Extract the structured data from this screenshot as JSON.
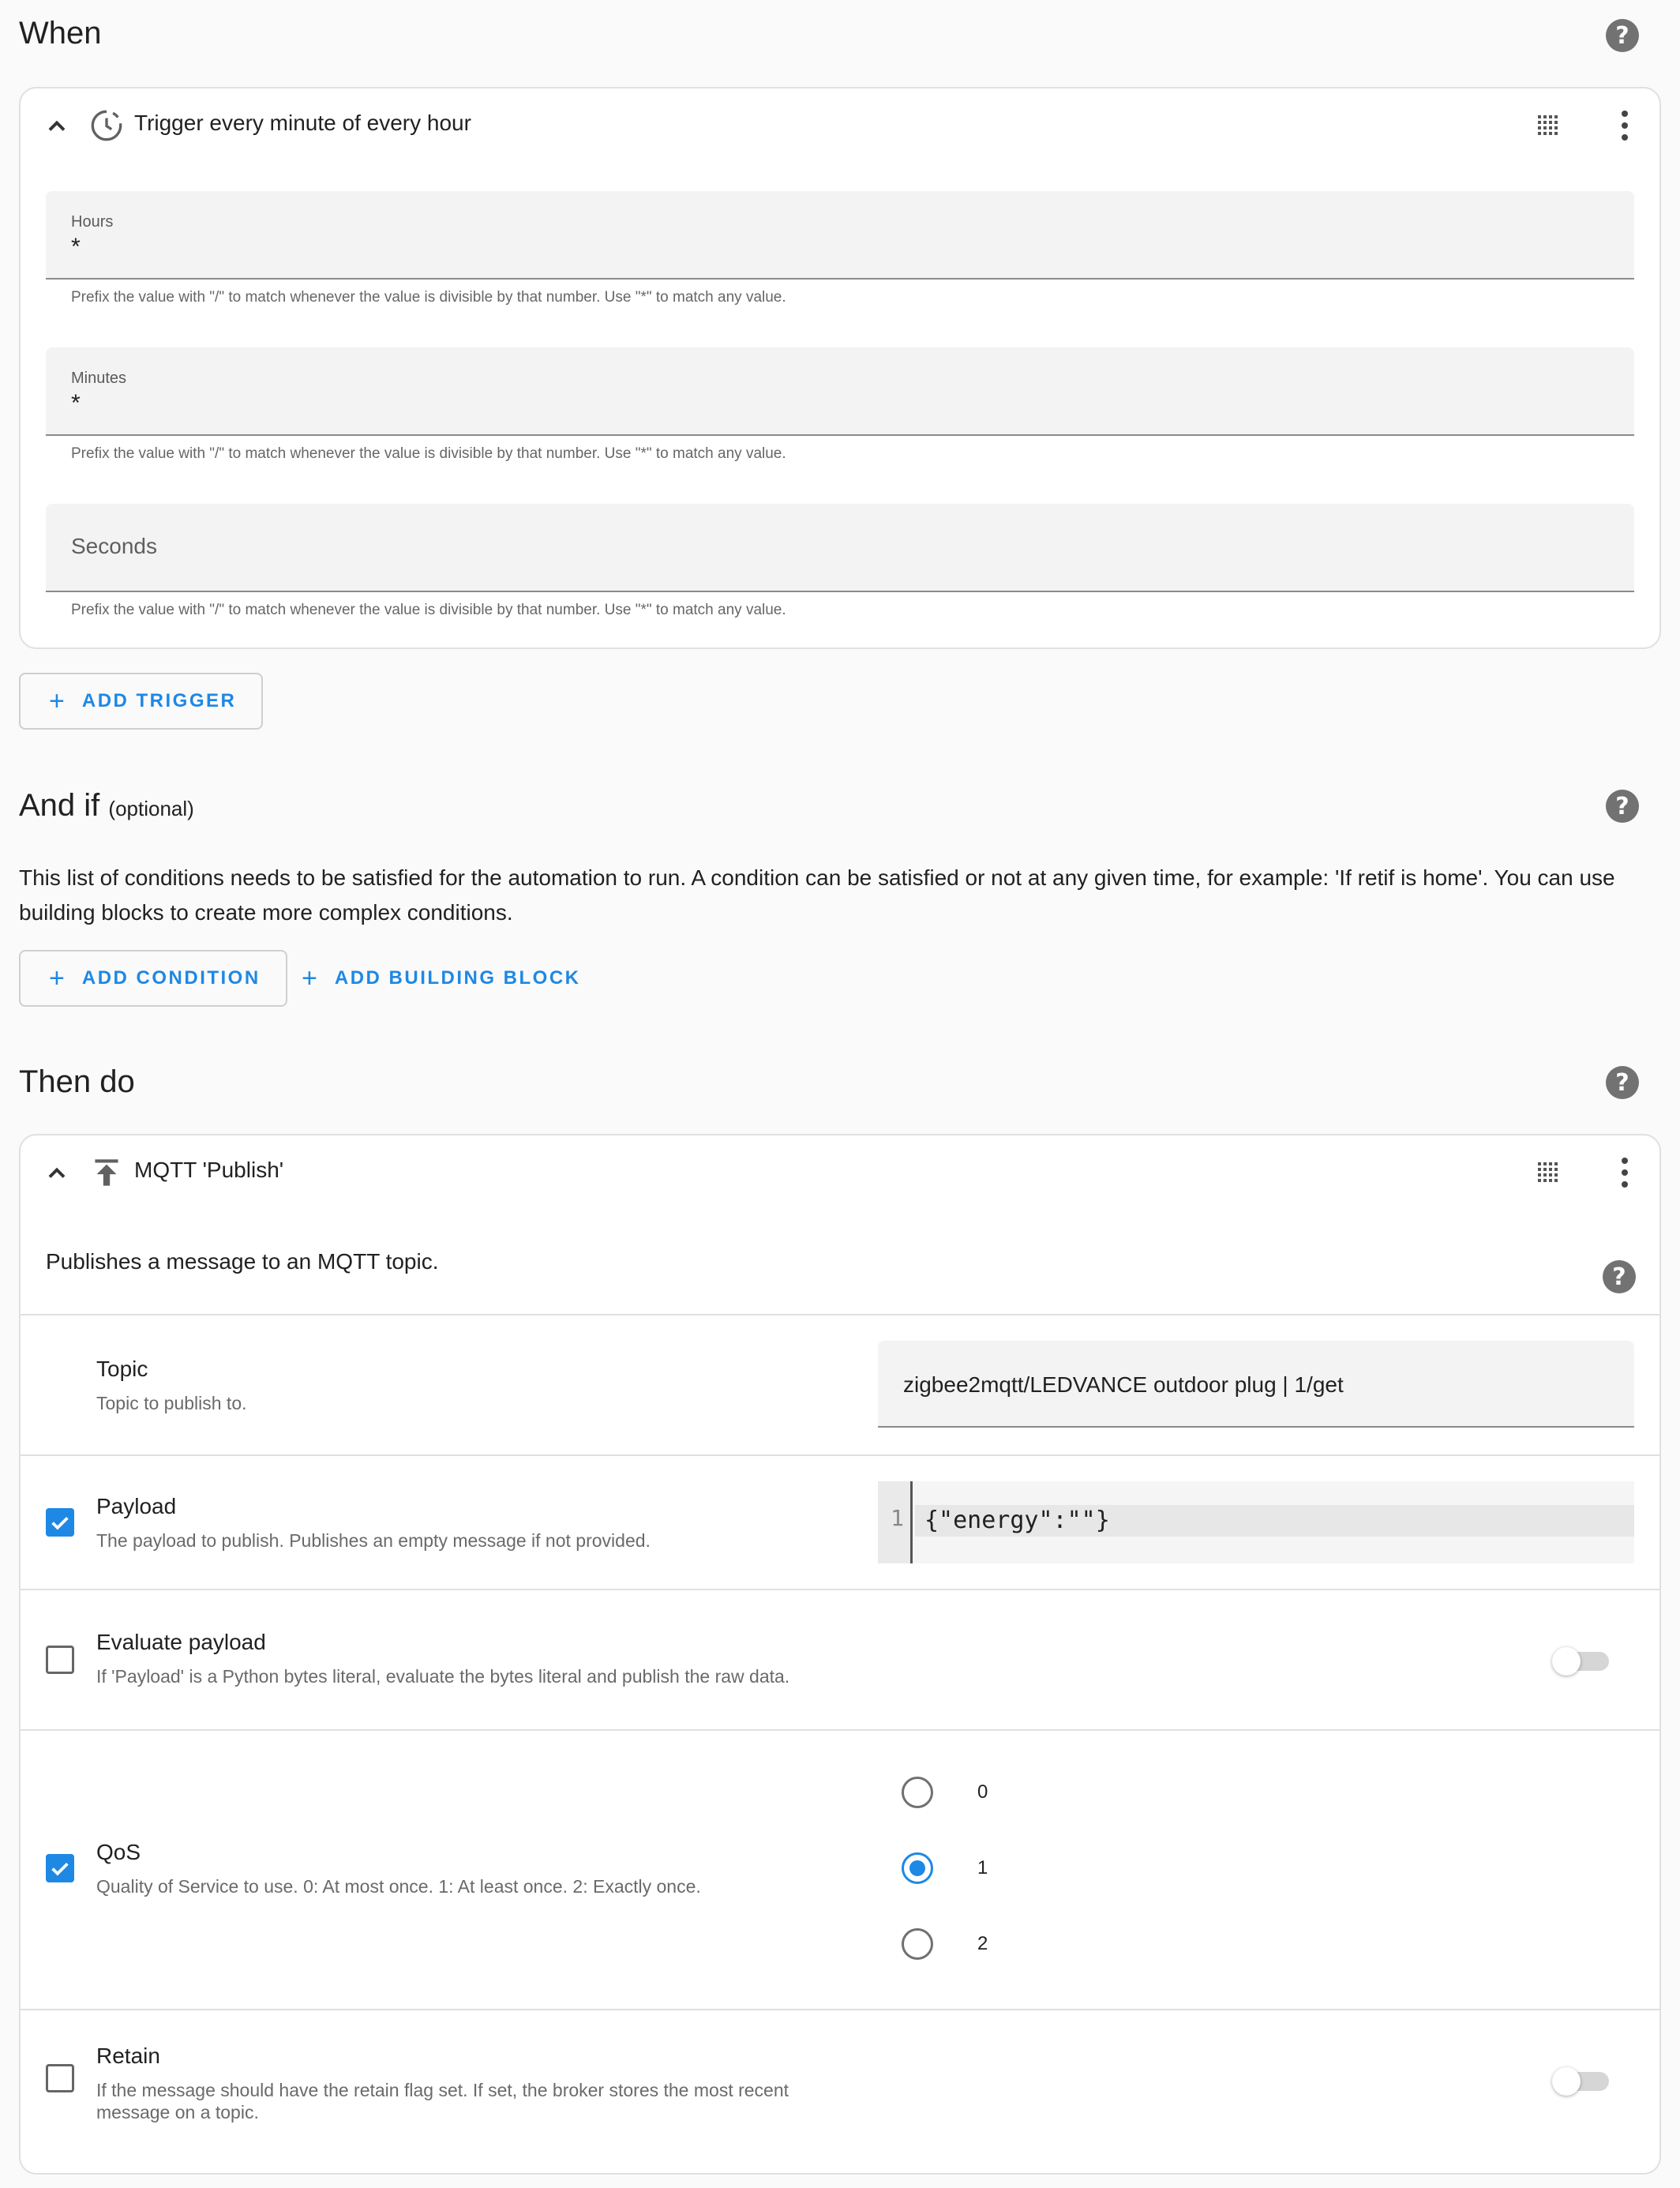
{
  "when": {
    "title": "When",
    "trigger": {
      "title": "Trigger every minute of every hour",
      "hours_label": "Hours",
      "hours_value": "*",
      "minutes_label": "Minutes",
      "minutes_value": "*",
      "seconds_placeholder": "Seconds",
      "hint": "Prefix the value with \"/\" to match whenever the value is divisible by that number. Use \"*\" to match any value."
    },
    "add_trigger_label": "ADD TRIGGER"
  },
  "and_if": {
    "title": "And if",
    "optional": "(optional)",
    "description": "This list of conditions needs to be satisfied for the automation to run. A condition can be satisfied or not at any given time, for example: 'If retif is home'. You can use building blocks to create more complex conditions.",
    "add_condition_label": "ADD CONDITION",
    "add_building_block_label": "ADD BUILDING BLOCK"
  },
  "then_do": {
    "title": "Then do",
    "action": {
      "title": "MQTT 'Publish'",
      "description": "Publishes a message to an MQTT topic.",
      "topic": {
        "label": "Topic",
        "desc": "Topic to publish to.",
        "value": "zigbee2mqtt/LEDVANCE outdoor plug | 1/get"
      },
      "payload": {
        "label": "Payload",
        "desc": "The payload to publish. Publishes an empty message if not provided.",
        "line_number": "1",
        "code": "{\"energy\":\"\"}",
        "checked": true
      },
      "evaluate_payload": {
        "label": "Evaluate payload",
        "desc": "If 'Payload' is a Python bytes literal, evaluate the bytes literal and publish the raw data.",
        "checked": false,
        "toggle_on": false
      },
      "qos": {
        "label": "QoS",
        "desc": "Quality of Service to use. 0: At most once. 1: At least once. 2: Exactly once.",
        "checked": true,
        "options": [
          "0",
          "1",
          "2"
        ],
        "selected": "1"
      },
      "retain": {
        "label": "Retain",
        "desc_line1": "If the message should have the retain flag set. If set, the broker stores the most recent",
        "desc_line2": "message on a topic.",
        "checked": false,
        "toggle_on": false
      }
    }
  },
  "icons": {
    "collapse": "chevron-up-icon",
    "trigger": "timer-clock-icon",
    "mqtt": "publish-upload-icon",
    "drag": "drag-grid-icon",
    "menu": "more-vertical-icon",
    "help": "help-circle-icon"
  },
  "colors": {
    "accent": "#1e88e5",
    "background": "#fafafa",
    "card": "#ffffff"
  }
}
